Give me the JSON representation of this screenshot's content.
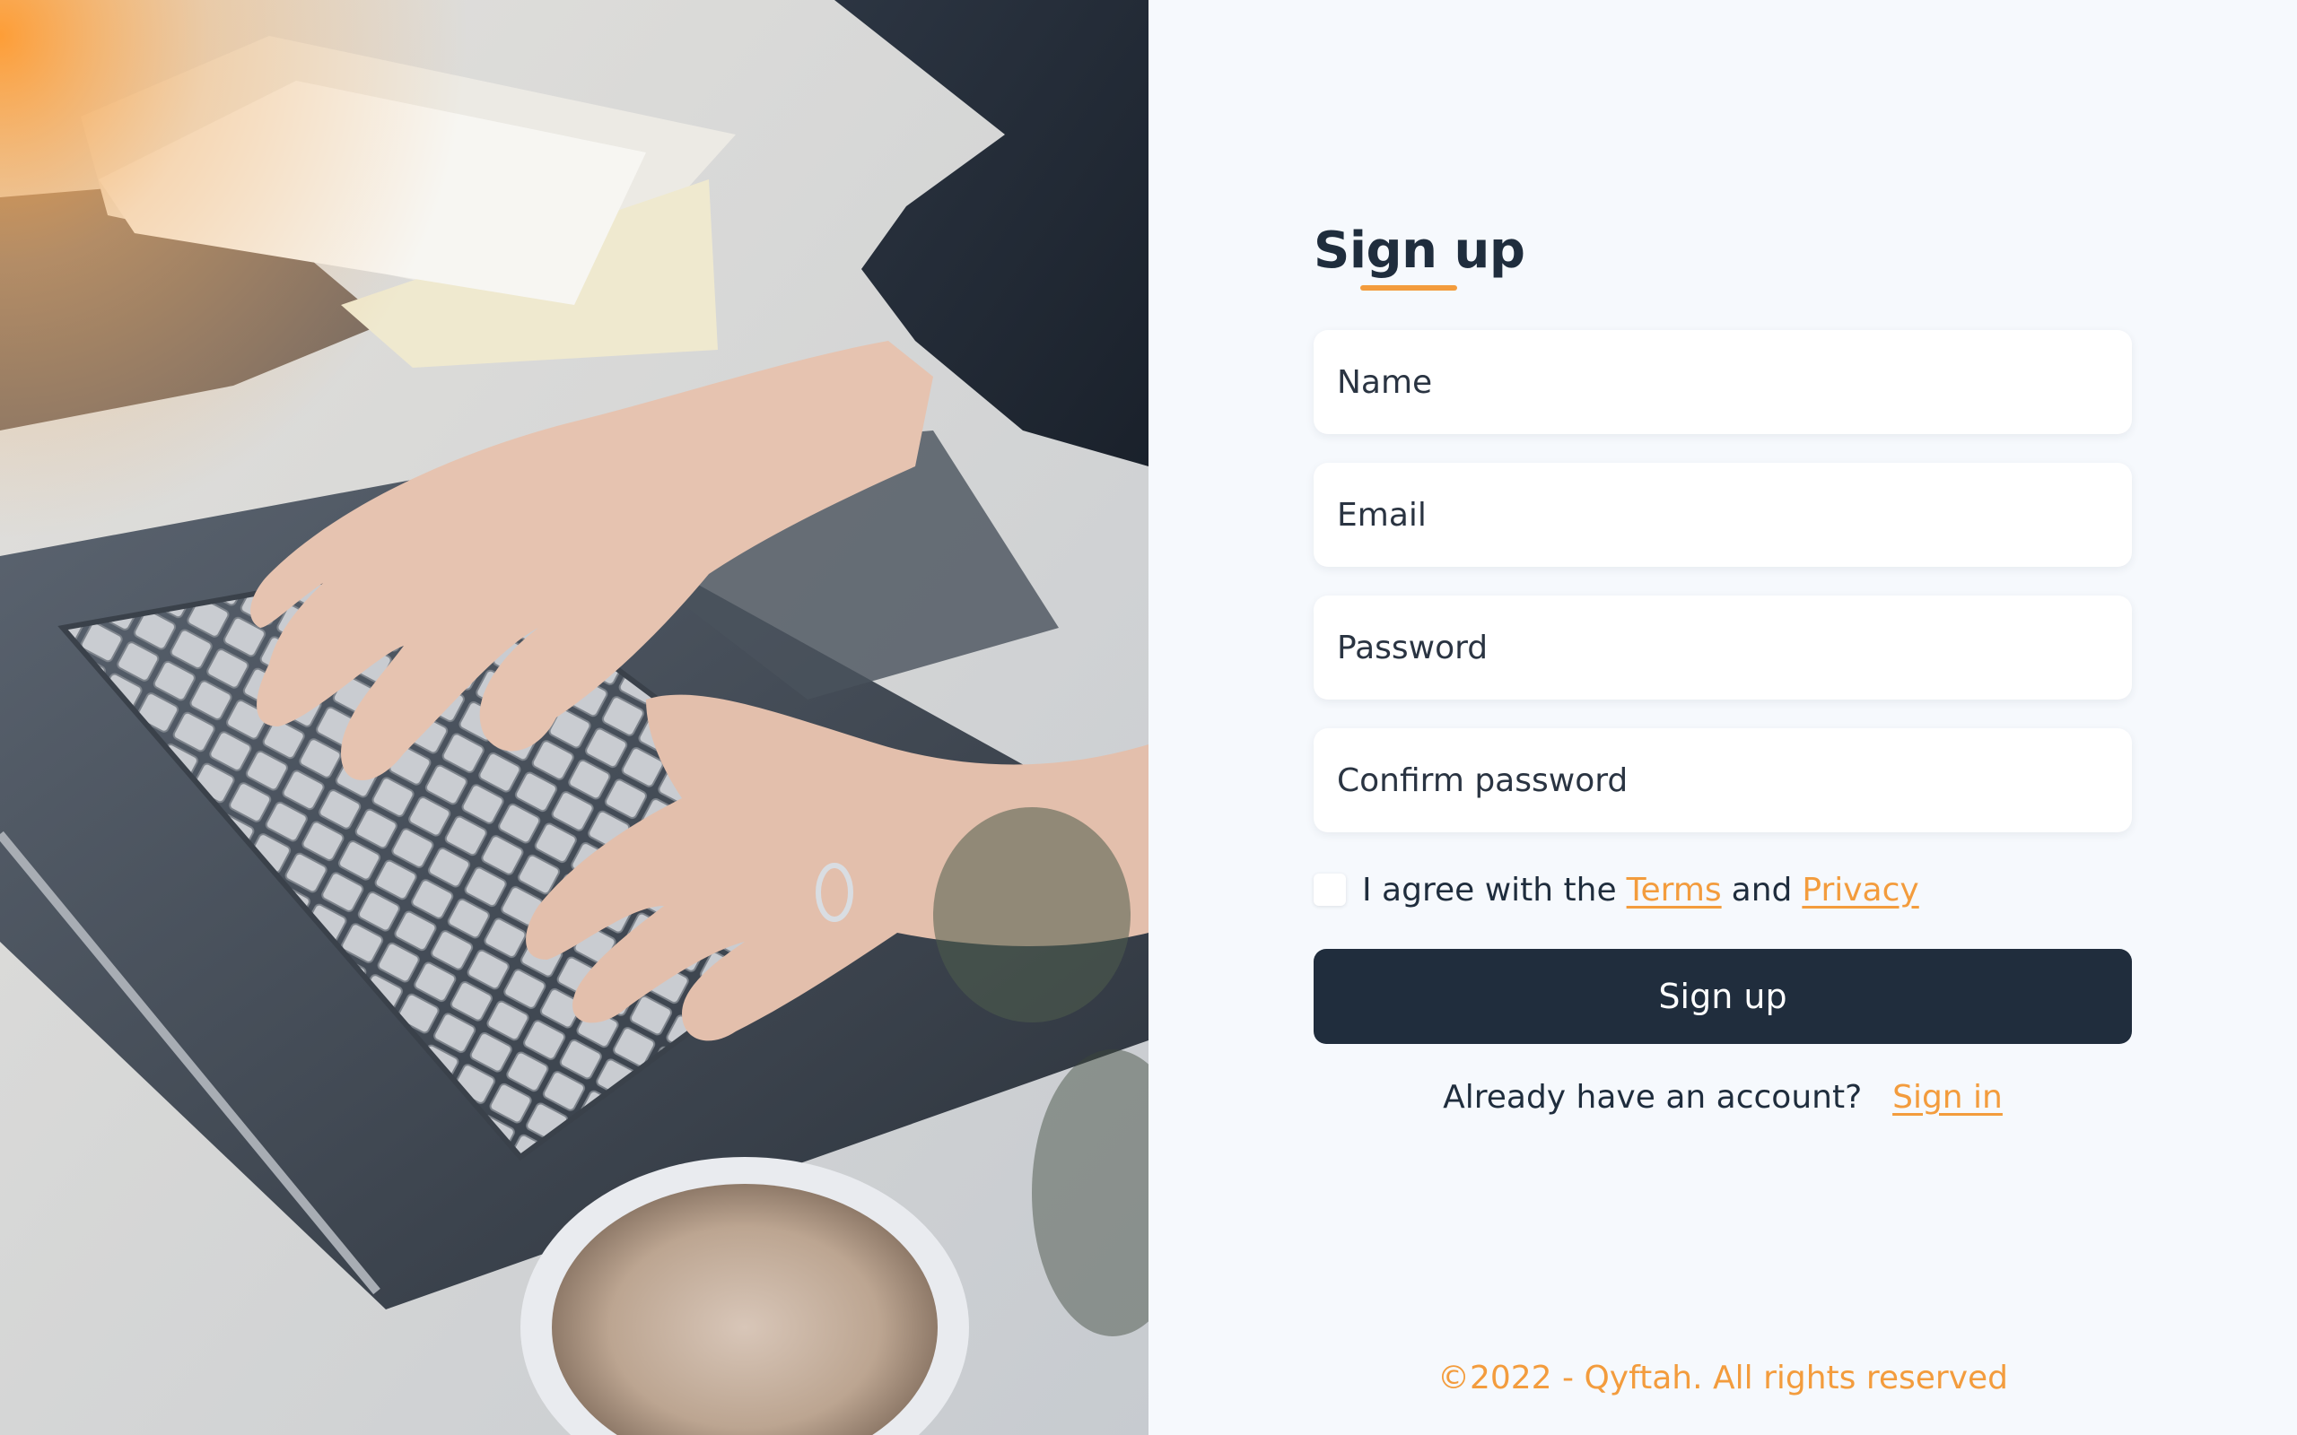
{
  "photo": {
    "alt": "Hands typing on a laptop keyboard next to a coffee cup"
  },
  "form": {
    "title": "Sign up",
    "fields": {
      "name_placeholder": "Name",
      "email_placeholder": "Email",
      "password_placeholder": "Password",
      "confirm_password_placeholder": "Confirm password",
      "name_value": "",
      "email_value": "",
      "password_value": "",
      "confirm_password_value": ""
    },
    "agree": {
      "prefix": "I agree with the",
      "terms_link": "Terms",
      "joiner": "and",
      "privacy_link": "Privacy",
      "checked": false
    },
    "submit_label": "Sign up",
    "already": {
      "text": "Already have an account?",
      "link": "Sign in"
    }
  },
  "footer": {
    "copyright": "©2022 - Qyftah. All rights reserved"
  },
  "colors": {
    "accent": "#f39c3d",
    "primary_dark": "#202d3d",
    "panel_background": "#f6f9fd"
  }
}
